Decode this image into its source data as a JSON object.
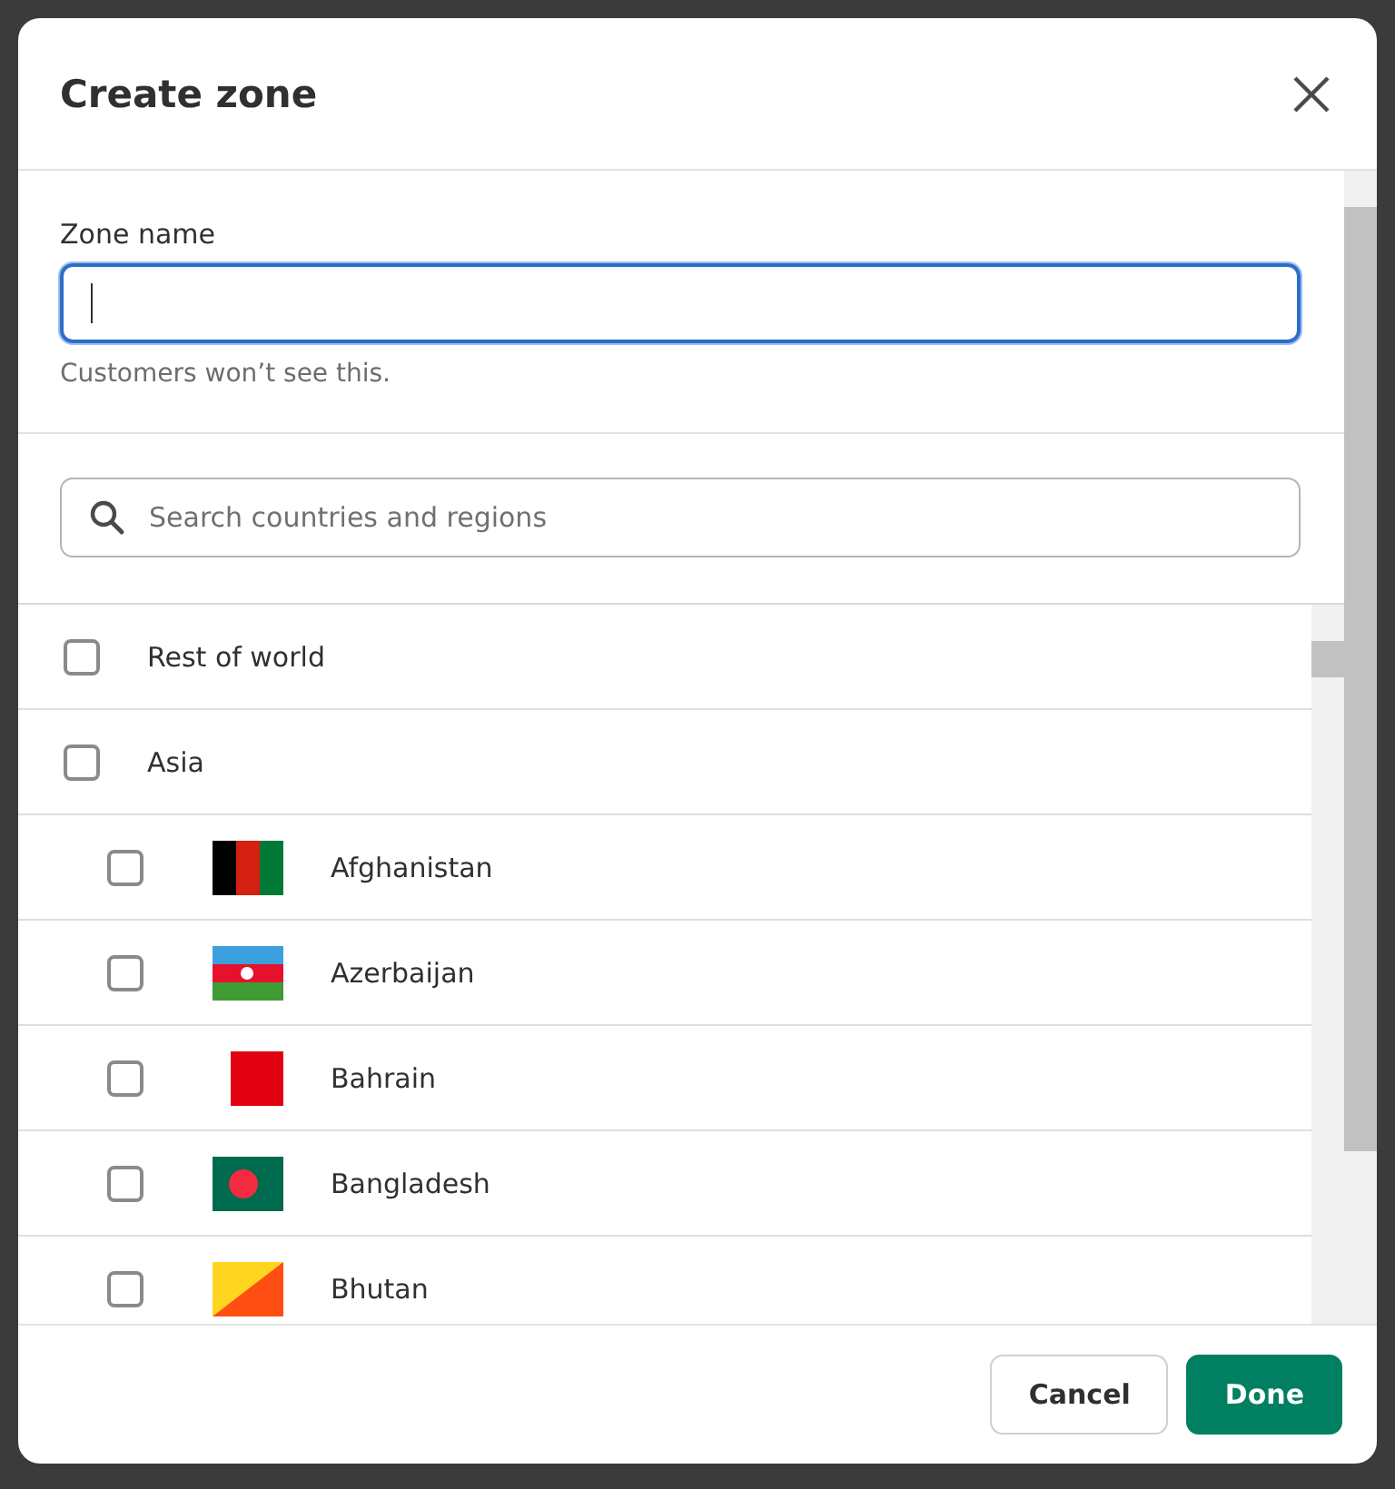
{
  "dialog": {
    "title": "Create zone"
  },
  "zone_name": {
    "label": "Zone name",
    "focused": true,
    "help": "Customers won’t see this."
  },
  "search": {
    "placeholder": "Search countries and regions"
  },
  "regions": [
    {
      "name": "Rest of world",
      "checked": false
    },
    {
      "name": "Asia",
      "checked": false,
      "children": [
        {
          "name": "Afghanistan",
          "checked": false
        },
        {
          "name": "Azerbaijan",
          "checked": false
        },
        {
          "name": "Bahrain",
          "checked": false
        },
        {
          "name": "Bangladesh",
          "checked": false
        },
        {
          "name": "Bhutan",
          "checked": false
        }
      ]
    }
  ],
  "buttons": [
    {
      "label": "Cancel",
      "kind": "secondary"
    },
    {
      "label": "Done",
      "kind": "primary"
    }
  ]
}
